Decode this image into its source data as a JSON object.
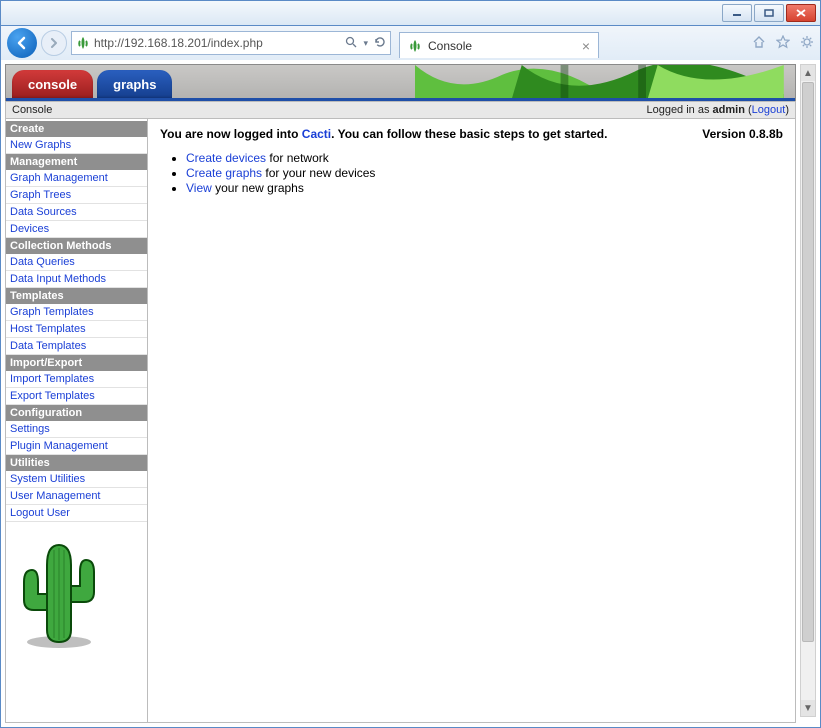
{
  "browser": {
    "url": "http://192.168.18.201/index.php",
    "tab_title": "Console"
  },
  "tabs": {
    "console": "console",
    "graphs": "graphs"
  },
  "infobar": {
    "breadcrumb": "Console",
    "logged_in_prefix": "Logged in as ",
    "user": "admin",
    "sep_open": " (",
    "logout": "Logout",
    "sep_close": ")"
  },
  "sidebar": {
    "sections": [
      {
        "header": "Create",
        "items": [
          "New Graphs"
        ]
      },
      {
        "header": "Management",
        "items": [
          "Graph Management",
          "Graph Trees",
          "Data Sources",
          "Devices"
        ]
      },
      {
        "header": "Collection Methods",
        "items": [
          "Data Queries",
          "Data Input Methods"
        ]
      },
      {
        "header": "Templates",
        "items": [
          "Graph Templates",
          "Host Templates",
          "Data Templates"
        ]
      },
      {
        "header": "Import/Export",
        "items": [
          "Import Templates",
          "Export Templates"
        ]
      },
      {
        "header": "Configuration",
        "items": [
          "Settings",
          "Plugin Management"
        ]
      },
      {
        "header": "Utilities",
        "items": [
          "System Utilities",
          "User Management",
          "Logout User"
        ]
      }
    ]
  },
  "main": {
    "welcome_pre": "You are now logged into ",
    "welcome_link": "Cacti",
    "welcome_post": ". You can follow these basic steps to get started.",
    "version": "Version 0.8.8b",
    "steps": [
      {
        "link": "Create devices",
        "text": " for network"
      },
      {
        "link": "Create graphs",
        "text": " for your new devices"
      },
      {
        "link": "View",
        "text": " your new graphs"
      }
    ]
  }
}
